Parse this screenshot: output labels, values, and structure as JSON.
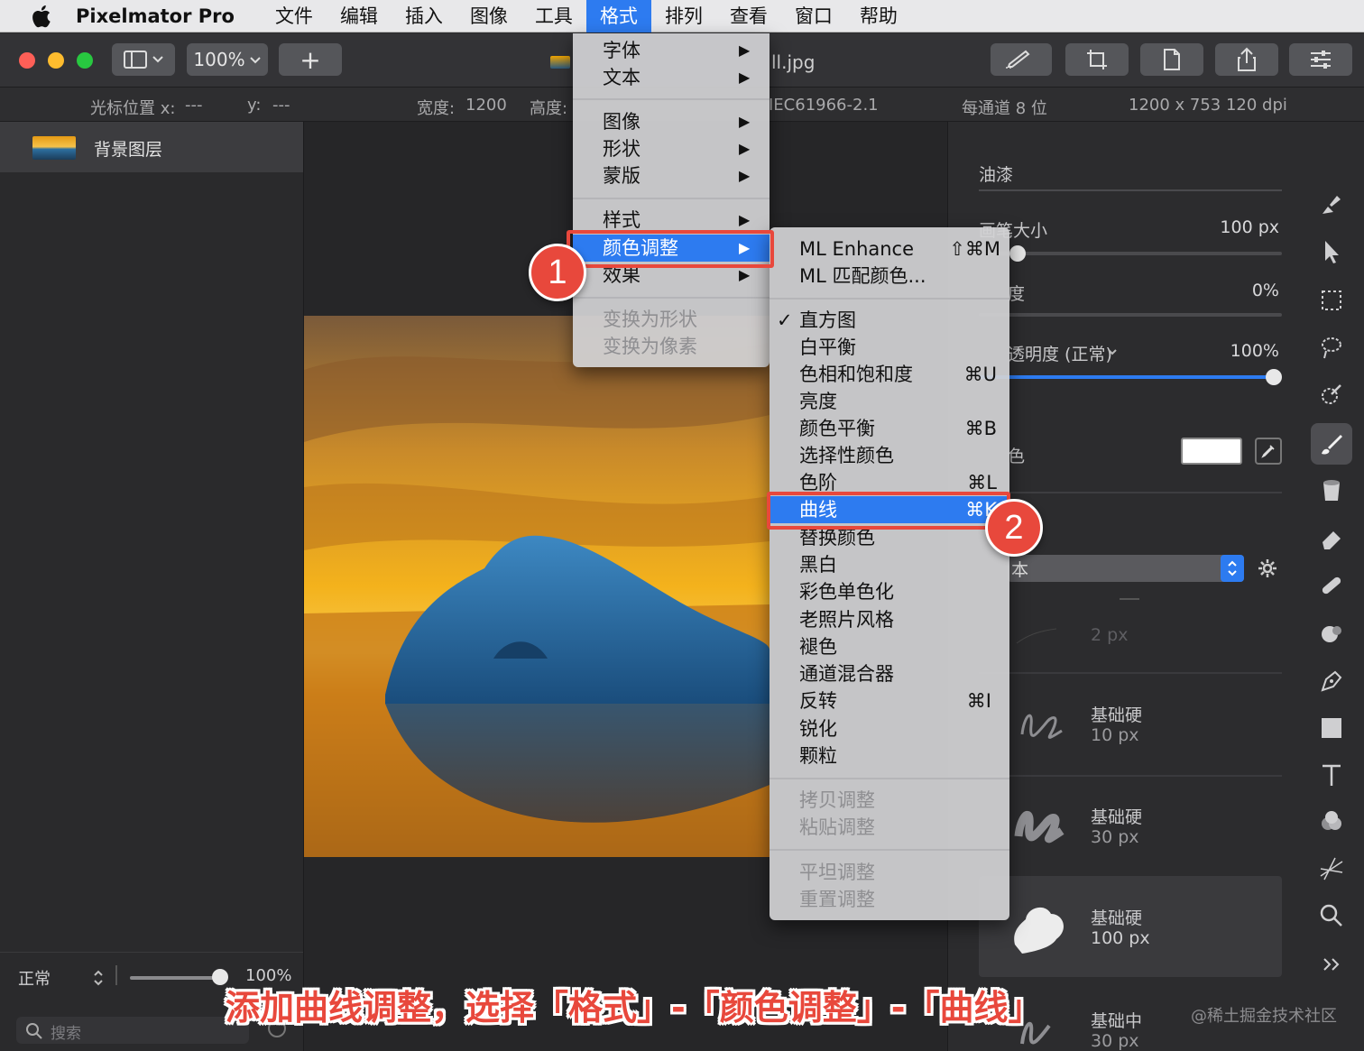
{
  "menubar": {
    "app_name": "Pixelmator Pro",
    "items": [
      "文件",
      "编辑",
      "插入",
      "图像",
      "工具",
      "格式",
      "排列",
      "查看",
      "窗口",
      "帮助"
    ],
    "active_index": 5
  },
  "toolbar": {
    "zoom": "100%",
    "add_label": "+",
    "filename": "ll.jpg"
  },
  "infobar": {
    "cursor_x_label": "光标位置 x:",
    "cursor_x_value": "---",
    "cursor_y_label": "y:",
    "cursor_y_value": "---",
    "width_label": "宽度:",
    "width_value": "1200",
    "height_label": "高度:",
    "color_profile": "IEC61966-2.1",
    "bit_depth": "每通道 8 位",
    "dimensions": "1200 x 753 120 dpi"
  },
  "layers": {
    "layer_name": "背景图层",
    "blend_mode": "正常",
    "opacity": "100%",
    "opacity_fraction": 1.0,
    "search_placeholder": "搜索"
  },
  "right_panel": {
    "section_title": "油漆",
    "brush_size_label": "画笔大小",
    "brush_size_value": "100 px",
    "row2_label": "度",
    "row2_value": "0%",
    "opacity_label": "透明度 (正常)",
    "opacity_value": "100%",
    "opacity_fraction": 1.0,
    "row4_label": "色",
    "preset_label": "本",
    "brush_thin_size": "2 px",
    "brushes": [
      {
        "name": "基础硬",
        "size": "10 px"
      },
      {
        "name": "基础硬",
        "size": "30 px"
      },
      {
        "name": "基础硬",
        "size": "100 px"
      },
      {
        "name": "基础中",
        "size": "30 px"
      }
    ]
  },
  "format_menu": {
    "items": [
      {
        "label": "字体",
        "arrow": "▶"
      },
      {
        "label": "文本",
        "arrow": "▶"
      },
      {
        "label": "图像",
        "arrow": "▶"
      },
      {
        "label": "形状",
        "arrow": "▶"
      },
      {
        "label": "蒙版",
        "arrow": "▶"
      },
      {
        "label": "样式",
        "arrow": "▶"
      },
      {
        "label": "颜色调整",
        "arrow": "▶"
      },
      {
        "label": "效果",
        "arrow": "▶"
      },
      {
        "label": "变换为形状"
      },
      {
        "label": "变换为像素"
      }
    ]
  },
  "color_menu": {
    "ml_items": [
      {
        "label": "ML Enhance",
        "shortcut": "⇧⌘M"
      },
      {
        "label": "ML 匹配颜色..."
      }
    ],
    "items": [
      {
        "label": "直方图",
        "check": "✓"
      },
      {
        "label": "白平衡"
      },
      {
        "label": "色相和饱和度",
        "shortcut": "⌘U"
      },
      {
        "label": "亮度"
      },
      {
        "label": "颜色平衡",
        "shortcut": "⌘B"
      },
      {
        "label": "选择性颜色"
      },
      {
        "label": "色阶",
        "shortcut": "⌘L"
      },
      {
        "label": "曲线",
        "shortcut": "⌘K"
      },
      {
        "label": "替换颜色"
      },
      {
        "label": "黑白"
      },
      {
        "label": "彩色单色化"
      },
      {
        "label": "老照片风格"
      },
      {
        "label": "褪色"
      },
      {
        "label": "通道混合器"
      },
      {
        "label": "反转",
        "shortcut": "⌘I"
      },
      {
        "label": "锐化"
      },
      {
        "label": "颗粒"
      }
    ],
    "copy_items": [
      "拷贝调整",
      "粘贴调整"
    ],
    "reset_items": [
      "平坦调整",
      "重置调整"
    ]
  },
  "annotations": {
    "badge1": "1",
    "badge2": "2",
    "caption": "添加曲线调整，选择「格式」-「颜色调整」-「曲线」",
    "watermark": "@稀土掘金技术社区"
  },
  "colors": {
    "accent": "#2d7bf0",
    "callout": "#e8483c"
  }
}
